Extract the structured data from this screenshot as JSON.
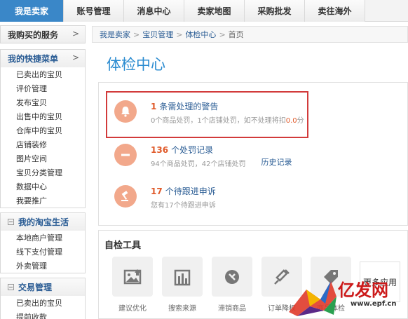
{
  "topnav": {
    "tabs": [
      {
        "label": "我是卖家",
        "active": true
      },
      {
        "label": "账号管理",
        "active": false
      },
      {
        "label": "消息中心",
        "active": false
      },
      {
        "label": "卖家地图",
        "active": false
      },
      {
        "label": "采购批发",
        "active": false
      },
      {
        "label": "卖往海外",
        "active": false
      }
    ]
  },
  "sidebar": {
    "bought": {
      "label": "我购买的服务",
      "chev": ">"
    },
    "quick": {
      "title": "我的快捷菜单",
      "chev": ">",
      "items": [
        "已卖出的宝贝",
        "评价管理",
        "发布宝贝",
        "出售中的宝贝",
        "仓库中的宝贝",
        "店铺装修",
        "图片空间",
        "宝贝分类管理",
        "数据中心",
        "我要推广"
      ]
    },
    "life": {
      "title": "我的淘宝生活",
      "sq": "−",
      "items": [
        "本地商户管理",
        "线下支付管理",
        "外卖管理"
      ]
    },
    "trade": {
      "title": "交易管理",
      "sq": "−",
      "items": [
        "已卖出的宝贝",
        "提前收款"
      ]
    }
  },
  "breadcrumb": {
    "items": [
      "我是卖家",
      "宝贝管理",
      "体检中心"
    ],
    "current": "首页",
    "sep": ">"
  },
  "page_title": "体检中心",
  "checkup": {
    "warning": {
      "num": "1",
      "title": "条需处理的警告",
      "sub_prefix": "0个商品处罚，1个店铺处罚，如不处理将扣",
      "sub_hl": "0.0",
      "sub_suffix": "分"
    },
    "penalty": {
      "num": "136",
      "title": "个处罚记录",
      "sub": "94个商品处罚，42个店铺处罚",
      "link": "历史记录"
    },
    "appeal": {
      "num": "17",
      "title": "个待跟进申诉",
      "sub": "您有17个待跟进申诉"
    }
  },
  "tools": {
    "title": "自检工具",
    "items": [
      {
        "label": "建议优化",
        "icon": "image-upload-icon"
      },
      {
        "label": "搜索来源",
        "icon": "chart-icon"
      },
      {
        "label": "滞销商品",
        "icon": "no-sale-icon"
      },
      {
        "label": "订单降权",
        "icon": "syringe-icon"
      },
      {
        "label": "商品体检",
        "icon": "tag-icon"
      }
    ],
    "more": "更多应用"
  },
  "watermark": {
    "text": "亿发网",
    "url": "www.epf.cn"
  },
  "colors": {
    "accent": "#3a87c8",
    "link": "#2a5c94",
    "warn": "#e05a2a",
    "icon_bg": "#f2a88b",
    "highlight": "#d23b3b"
  }
}
